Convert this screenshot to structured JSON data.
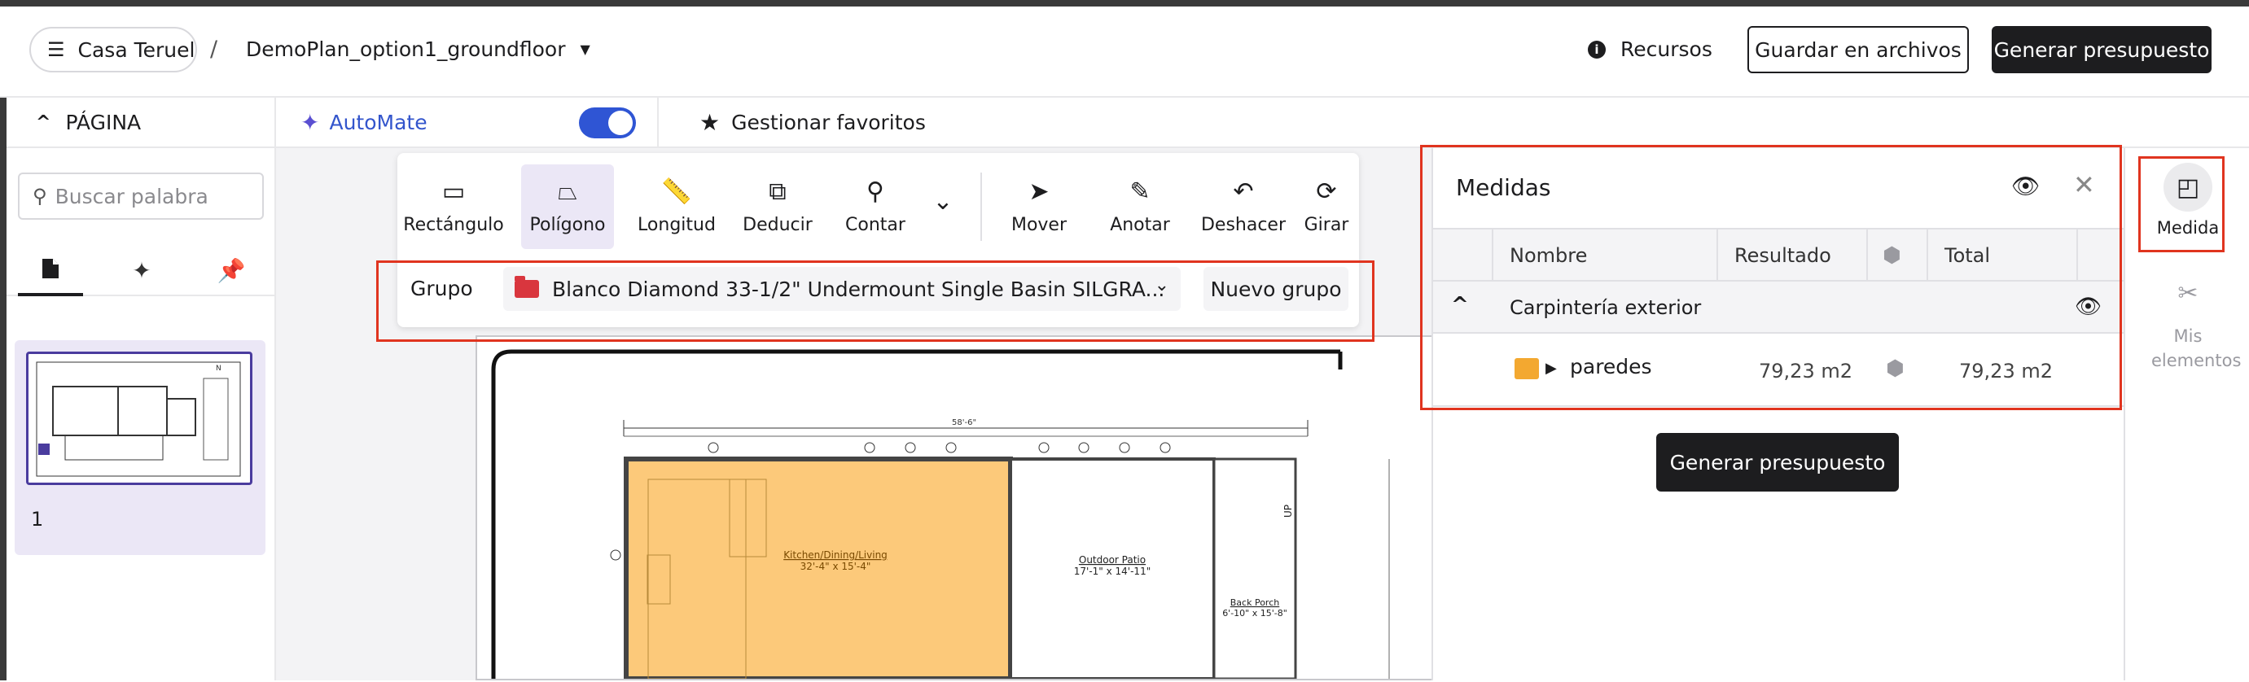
{
  "header": {
    "project_label": "Casa Teruel",
    "separator": "/",
    "plan_name": "DemoPlan_option1_groundfloor",
    "resources_label": "Recursos",
    "save_files_label": "Guardar en archivos",
    "generate_budget_label": "Generar presupuesto"
  },
  "sidebar": {
    "section_title": "PÁGINA",
    "search_placeholder": "Buscar palabra",
    "tabs": [
      {
        "icon": "document-icon"
      },
      {
        "icon": "sparkle-icon"
      },
      {
        "icon": "pin-icon"
      }
    ],
    "pages": [
      {
        "number": "1"
      }
    ]
  },
  "subbar": {
    "automate_label": "AutoMate",
    "automate_enabled": true,
    "favorites_label": "Gestionar favoritos"
  },
  "toolbar": {
    "tools": [
      {
        "label": "Rectángulo",
        "icon": "rectangle-icon"
      },
      {
        "label": "Polígono",
        "icon": "polygon-icon",
        "active": true
      },
      {
        "label": "Longitud",
        "icon": "ruler-icon"
      },
      {
        "label": "Deducir",
        "icon": "deduct-icon"
      },
      {
        "label": "Contar",
        "icon": "count-icon"
      },
      {
        "label": "Mover",
        "icon": "cursor-icon"
      },
      {
        "label": "Anotar",
        "icon": "pen-icon"
      },
      {
        "label": "Deshacer",
        "icon": "undo-icon"
      },
      {
        "label": "Girar",
        "icon": "rotate-icon"
      }
    ],
    "group_label": "Grupo",
    "group_value": "Blanco Diamond 33-1/2\" Undermount Single Basin SILGRA...",
    "new_group_label": "Nuevo grupo"
  },
  "plan": {
    "room1": "Kitchen/Dining/Living",
    "room1_dims": "32'-4\" x 15'-4\"",
    "room2": "Outdoor Patio",
    "room2_dims": "17'-1\" x 14'-11\"",
    "room3": "Back Porch",
    "room3_dims": "6'-10\" x 15'-8\"",
    "overall_dim": "58'-6\"",
    "up_label": "UP"
  },
  "medidas": {
    "title": "Medidas",
    "columns": [
      "Nombre",
      "Resultado",
      "Total"
    ],
    "group_name": "Carpintería exterior",
    "item_name": "paredes",
    "item_result": "79,23 m2",
    "item_total": "79,23 m2",
    "generate_label": "Generar presupuesto"
  },
  "rail": {
    "measure_label": "Medida",
    "my_elements_label": "Mis elementos"
  },
  "colors": {
    "accent": "#2f55d4",
    "highlight_box": "#e0341f",
    "room_fill": "#fcc97a",
    "dark_button": "#1d1d1f"
  }
}
